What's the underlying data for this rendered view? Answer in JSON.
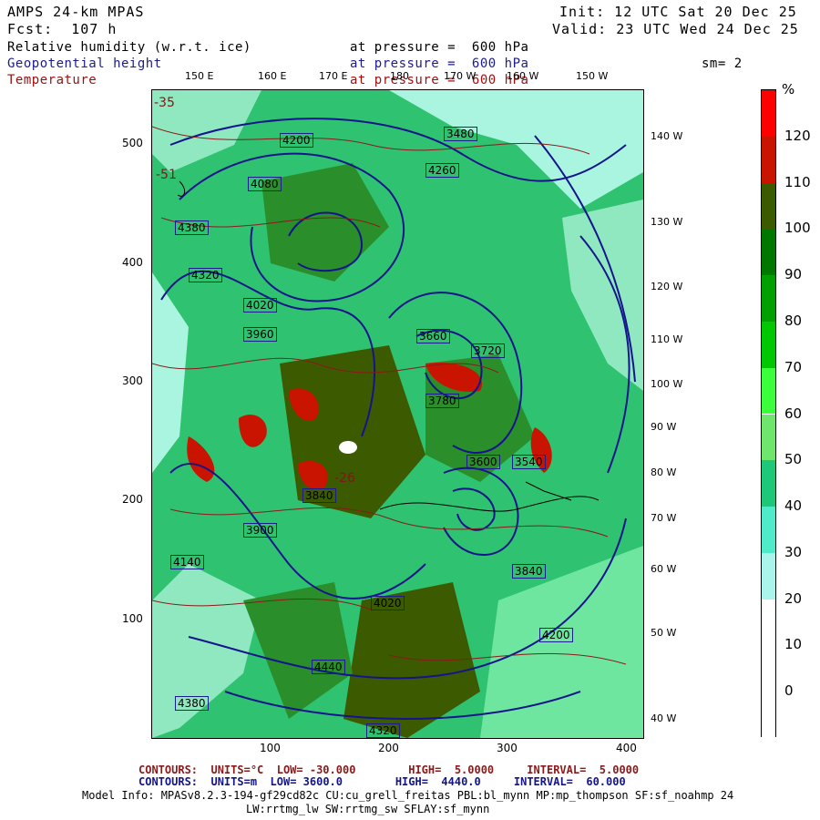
{
  "header": {
    "model": "AMPS 24-km MPAS",
    "fcst": "Fcst:  107 h",
    "init": "Init: 12 UTC Sat 20 Dec 25",
    "valid": "Valid: 23 UTC Wed 24 Dec 25"
  },
  "fields": [
    {
      "name": "Relative humidity (w.r.t. ice)",
      "level": "at pressure =  600 hPa",
      "color": "#000000"
    },
    {
      "name": "Geopotential height",
      "level": "at pressure =  600 hPa",
      "color": "#1c1c8c"
    },
    {
      "name": "Temperature",
      "level": "at pressure =  600 hPa",
      "color": "#a01010"
    }
  ],
  "smoothing": "sm= 2",
  "map": {
    "x_ticks": [
      "100",
      "200",
      "300",
      "400"
    ],
    "y_ticks": [
      "500",
      "400",
      "300",
      "200",
      "100"
    ],
    "top_longitudes": [
      "150 E",
      "160 E",
      "170 E",
      "180",
      "170 W",
      "160 W",
      "150 W"
    ],
    "right_longitudes": [
      "140 W",
      "130 W",
      "120 W",
      "110 W",
      "100 W",
      "90 W",
      "80 W",
      "70 W",
      "60 W",
      "50 W",
      "40 W"
    ],
    "height_contour_labels": [
      "4380",
      "4200",
      "4260",
      "4080",
      "4320",
      "4020",
      "3900",
      "3960",
      "4140",
      "3840",
      "3780",
      "3720",
      "3660",
      "3600",
      "3540",
      "3480",
      "4440"
    ],
    "temperature_labels": [
      "-35",
      "-51",
      "-26"
    ]
  },
  "colorbar": {
    "unit": "%",
    "ticks": [
      "120",
      "110",
      "100",
      "90",
      "80",
      "70",
      "60",
      "50",
      "40",
      "30",
      "20",
      "10",
      "0"
    ],
    "colors": [
      "#ff0000",
      "#c81400",
      "#3c5a00",
      "#007800",
      "#00a000",
      "#00c800",
      "#3cff3c",
      "#6ee66e",
      "#1ec878",
      "#50ebc8",
      "#aaf5eb",
      "#ffffff",
      "#ffffff",
      "#ffffff"
    ]
  },
  "footer": {
    "temp_line": [
      "CONTOURS:",
      "UNITS=°C",
      "LOW= -30.000",
      "HIGH=",
      "5.0000",
      "INTERVAL=",
      "5.0000"
    ],
    "height_line": [
      "CONTOURS:",
      "UNITS=m",
      "LOW=",
      "3600.0",
      "HIGH=",
      "4440.0",
      "INTERVAL=",
      "60.000"
    ],
    "model_info_1": "Model Info: MPASv8.2.3-194-gf29cd82c CU:cu_grell_freitas PBL:bl_mynn MP:mp_thompson SF:sf_noahmp 24",
    "model_info_2": "LW:rrtmg_lw SW:rrtmg_sw SFLAY:sf_mynn"
  }
}
